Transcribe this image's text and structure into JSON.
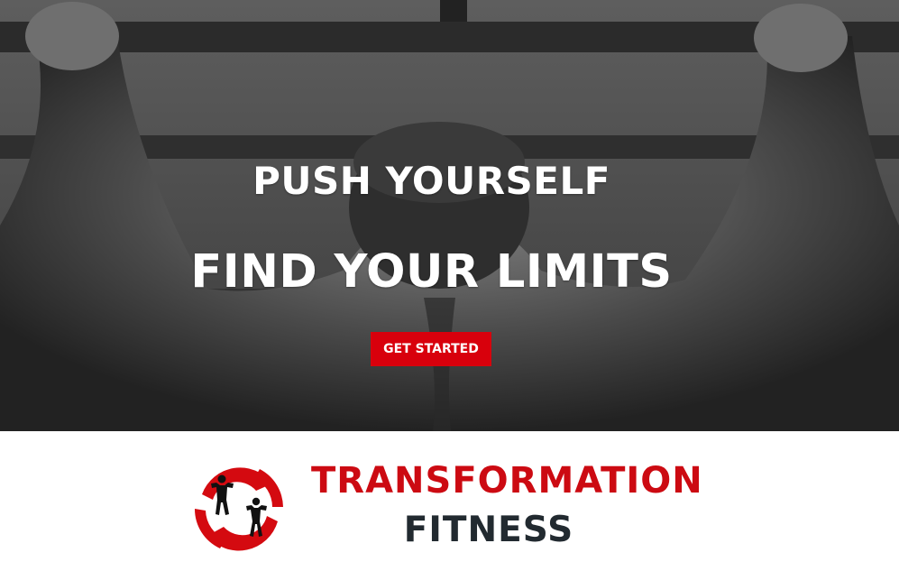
{
  "hero": {
    "headline_primary": "PUSH YOURSELF",
    "headline_secondary": "FIND YOUR LIMITS",
    "cta_label": "GET STARTED"
  },
  "brand": {
    "name_line_1": "TRANSFORMATION",
    "name_line_2": "FITNESS",
    "logo_icon": "bodybuilders-logo"
  },
  "colors": {
    "accent_red": "#d8000c",
    "brand_red": "#cc0a12",
    "brand_dark": "#222a30",
    "background": "#ffffff"
  }
}
